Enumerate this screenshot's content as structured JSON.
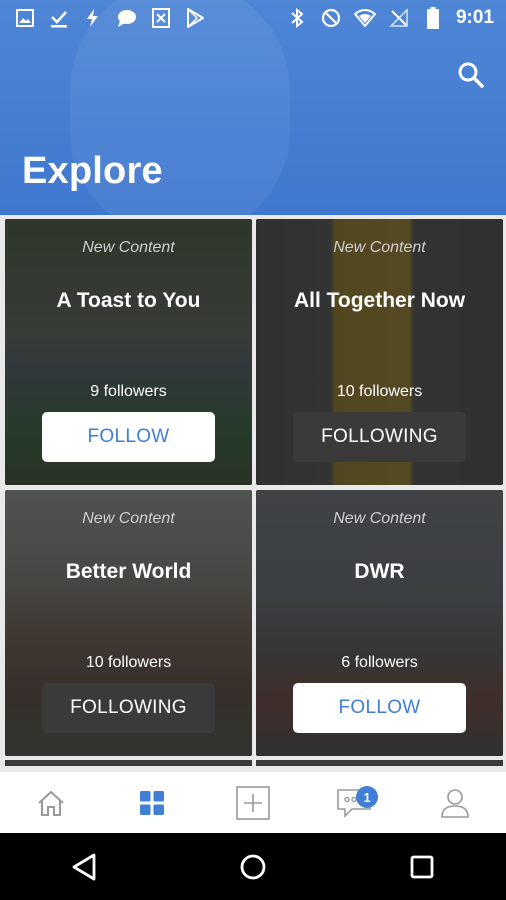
{
  "status_bar": {
    "time": "9:01",
    "left_icons": [
      "image-icon",
      "download-done-icon",
      "flash-icon",
      "chat-bubble-icon",
      "spreadsheet-icon",
      "play-store-icon"
    ],
    "right_icons": [
      "bluetooth-icon",
      "do-not-disturb-icon",
      "wifi-icon",
      "no-signal-icon",
      "battery-icon"
    ]
  },
  "header": {
    "title": "Explore",
    "search_icon": "search-icon"
  },
  "cards": [
    {
      "tag": "New Content",
      "name": "A Toast to You",
      "followers": "9 followers",
      "button": "FOLLOW",
      "state": "follow"
    },
    {
      "tag": "New Content",
      "name": "All Together Now",
      "followers": "10 followers",
      "button": "FOLLOWING",
      "state": "following"
    },
    {
      "tag": "New Content",
      "name": "Better World",
      "followers": "10 followers",
      "button": "FOLLOWING",
      "state": "following"
    },
    {
      "tag": "New Content",
      "name": "DWR",
      "followers": "6 followers",
      "button": "FOLLOW",
      "state": "follow"
    }
  ],
  "bottom_nav": {
    "items": [
      "home-icon",
      "explore-grid-icon",
      "add-post-icon",
      "messages-icon",
      "profile-icon"
    ],
    "active": "explore-grid-icon",
    "messages_badge": "1"
  },
  "colors": {
    "accent": "#3f7fd6",
    "header": "#4a80d4"
  }
}
